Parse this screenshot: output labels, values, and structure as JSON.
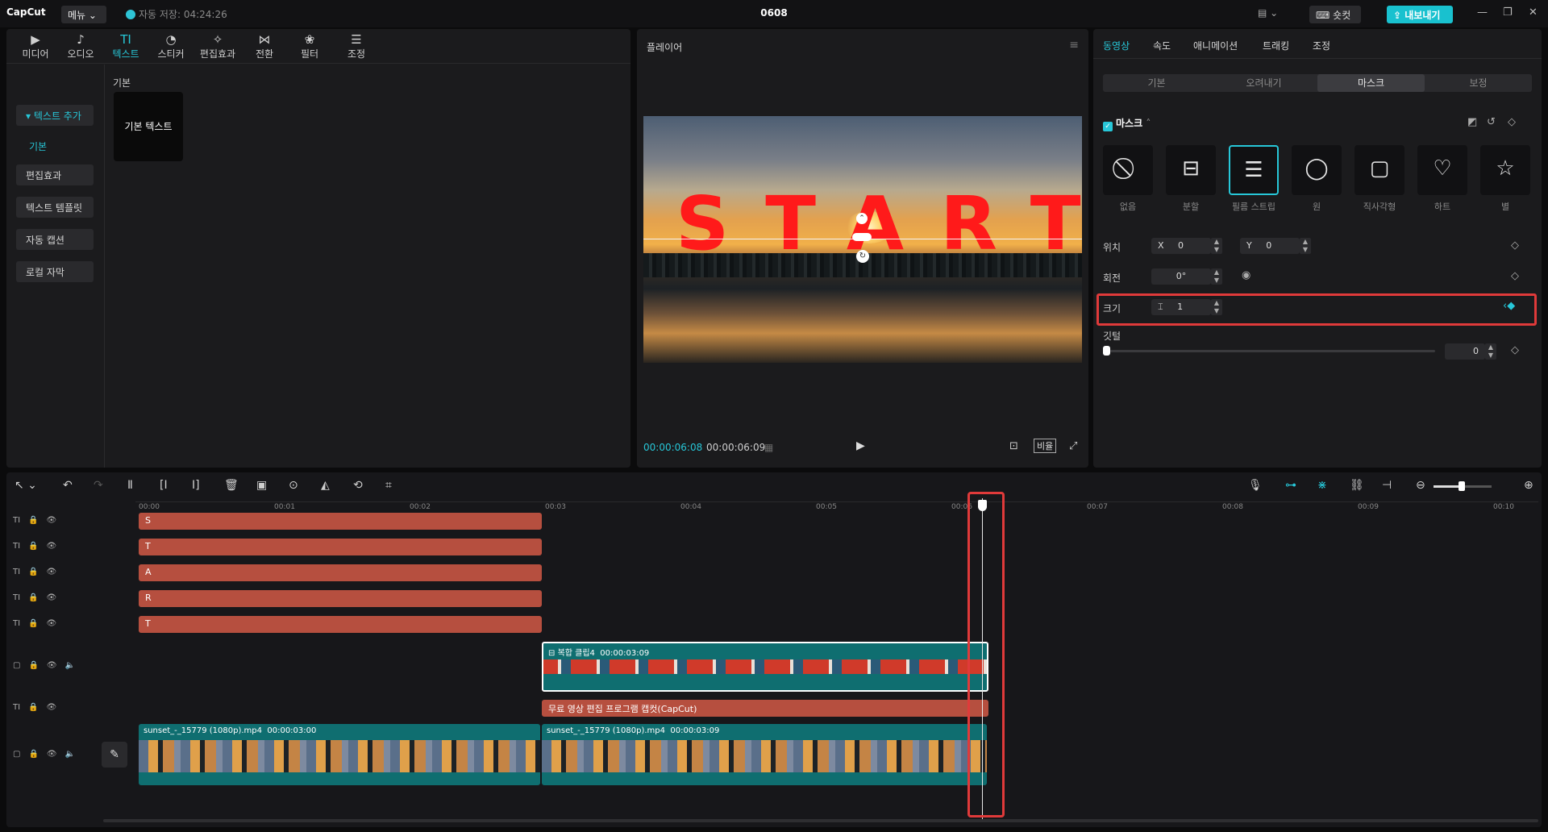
{
  "titlebar": {
    "logo": "CapCut",
    "menu_label": "메뉴",
    "autosave": "자동 저장: 04:24:26",
    "project_title": "0608",
    "shortcut_label": "숏컷",
    "export_label": "내보내기"
  },
  "tool_tabs": [
    {
      "label": "미디어",
      "icon": "media-icon"
    },
    {
      "label": "오디오",
      "icon": "audio-icon"
    },
    {
      "label": "텍스트",
      "icon": "text-icon"
    },
    {
      "label": "스티커",
      "icon": "sticker-icon"
    },
    {
      "label": "편집효과",
      "icon": "effects-icon"
    },
    {
      "label": "전환",
      "icon": "transition-icon"
    },
    {
      "label": "필터",
      "icon": "filter-icon"
    },
    {
      "label": "조정",
      "icon": "adjust-icon"
    }
  ],
  "sidebar": {
    "add_text": "텍스트 추가",
    "basic": "기본",
    "items": [
      "편집효과",
      "텍스트 템플릿",
      "자동 캡션",
      "로컬 자막"
    ]
  },
  "content": {
    "section_label": "기본",
    "tile_label": "기본 텍스트"
  },
  "player": {
    "title": "플레이어",
    "overlay_text": "START",
    "current_time": "00:00:06:08",
    "total_time": "00:00:06:09",
    "ratio_label": "비율"
  },
  "right": {
    "tabs": [
      "동영상",
      "속도",
      "애니메이션",
      "트래킹",
      "조정"
    ],
    "subtabs": [
      "기본",
      "오려내기",
      "마스크",
      "보정"
    ],
    "mask_header": "마스크",
    "mask_options": [
      "없음",
      "분할",
      "필름 스트립",
      "원",
      "직사각형",
      "하트",
      "별"
    ],
    "position_label": "위치",
    "x_label": "X",
    "x_value": "0",
    "y_label": "Y",
    "y_value": "0",
    "rotation_label": "회전",
    "rotation_value": "0°",
    "size_label": "크기",
    "size_value": "1",
    "feather_label": "깃털",
    "feather_value": "0"
  },
  "timeline": {
    "ticks": [
      "00:00",
      "00:01",
      "00:02",
      "00:03",
      "00:04",
      "00:05",
      "00:06",
      "00:07",
      "00:08",
      "00:09",
      "00:10"
    ],
    "text_clips": [
      "S",
      "T",
      "A",
      "R",
      "T"
    ],
    "compound_label": "복합 클립4",
    "compound_duration": "00:00:03:09",
    "capcut_clip": "무료 영상 편집 프로그램 캡컷(CapCut)",
    "video1_label": "sunset_-_15779 (1080p).mp4",
    "video1_duration": "00:00:03:00",
    "video2_label": "sunset_-_15779 (1080p).mp4",
    "video2_duration": "00:00:03:09"
  },
  "colors": {
    "accent": "#27c7d8",
    "text_clip": "#b64f3f",
    "video_clip": "#0f6e70",
    "highlight": "#e03a3a"
  }
}
